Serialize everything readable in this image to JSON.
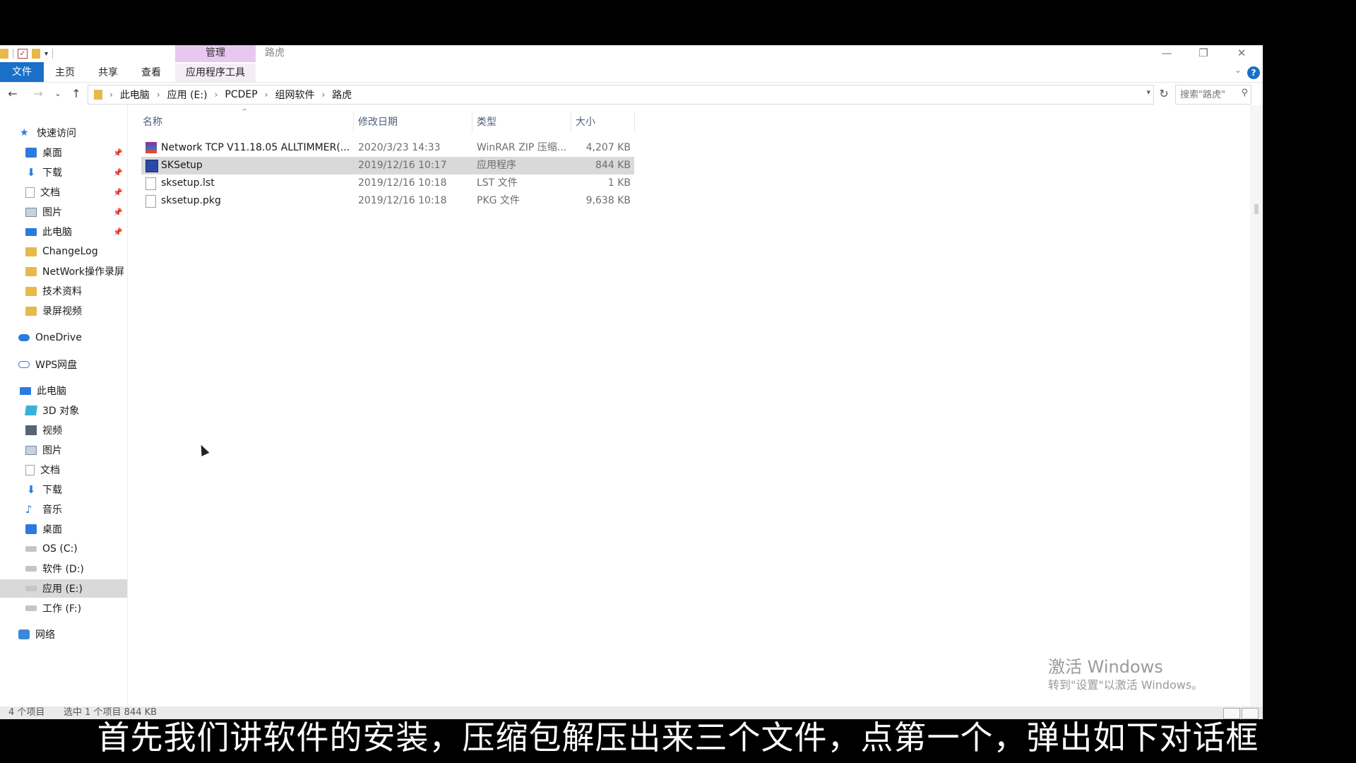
{
  "window": {
    "title": "路虎",
    "context_tab": "管理",
    "controls": {
      "minimize": "—",
      "maximize": "❐",
      "close": "✕"
    }
  },
  "ribbon": {
    "tabs": [
      {
        "label": "文件"
      },
      {
        "label": "主页"
      },
      {
        "label": "共享"
      },
      {
        "label": "查看"
      },
      {
        "label": "应用程序工具"
      }
    ],
    "help": "?"
  },
  "address": {
    "crumbs": [
      "此电脑",
      "应用 (E:)",
      "PCDEP",
      "组网软件",
      "路虎"
    ],
    "search_placeholder": "搜索\"路虎\""
  },
  "sidebar": {
    "quick_access": "快速访问",
    "quick_items": [
      "桌面",
      "下载",
      "文档",
      "图片",
      "此电脑"
    ],
    "folders": [
      "ChangeLog",
      "NetWork操作录屏",
      "技术资料",
      "录屏视频"
    ],
    "onedrive": "OneDrive",
    "wps": "WPS网盘",
    "this_pc": "此电脑",
    "pc_items": [
      "3D 对象",
      "视频",
      "图片",
      "文档",
      "下载",
      "音乐",
      "桌面",
      "OS (C:)",
      "软件 (D:)",
      "应用 (E:)",
      "工作 (F:)"
    ],
    "network": "网络",
    "selected": "应用 (E:)"
  },
  "columns": {
    "name": "名称",
    "date": "修改日期",
    "type": "类型",
    "size": "大小"
  },
  "files": [
    {
      "name": "Network TCP V11.18.05 ALLTIMMER(...",
      "date": "2020/3/23 14:33",
      "type": "WinRAR ZIP 压缩...",
      "size": "4,207 KB",
      "icon": "winrar-icon"
    },
    {
      "name": "SKSetup",
      "date": "2019/12/16 10:17",
      "type": "应用程序",
      "size": "844 KB",
      "icon": "exe-icon"
    },
    {
      "name": "sksetup.lst",
      "date": "2019/12/16 10:18",
      "type": "LST 文件",
      "size": "1 KB",
      "icon": "file-icon"
    },
    {
      "name": "sksetup.pkg",
      "date": "2019/12/16 10:18",
      "type": "PKG 文件",
      "size": "9,638 KB",
      "icon": "file-icon"
    }
  ],
  "selected_file": "SKSetup",
  "watermark": {
    "line1": "激活 Windows",
    "line2": "转到\"设置\"以激活 Windows。"
  },
  "status": {
    "count": "4 个项目",
    "selection": "选中 1 个项目  844 KB"
  },
  "subtitle": "首先我们讲软件的安装，压缩包解压出来三个文件，点第一个，弹出如下对话框",
  "colors": {
    "accent": "#1a6fc8",
    "context_tab": "#e8c8f0",
    "selected_row": "#d9d9d9"
  }
}
